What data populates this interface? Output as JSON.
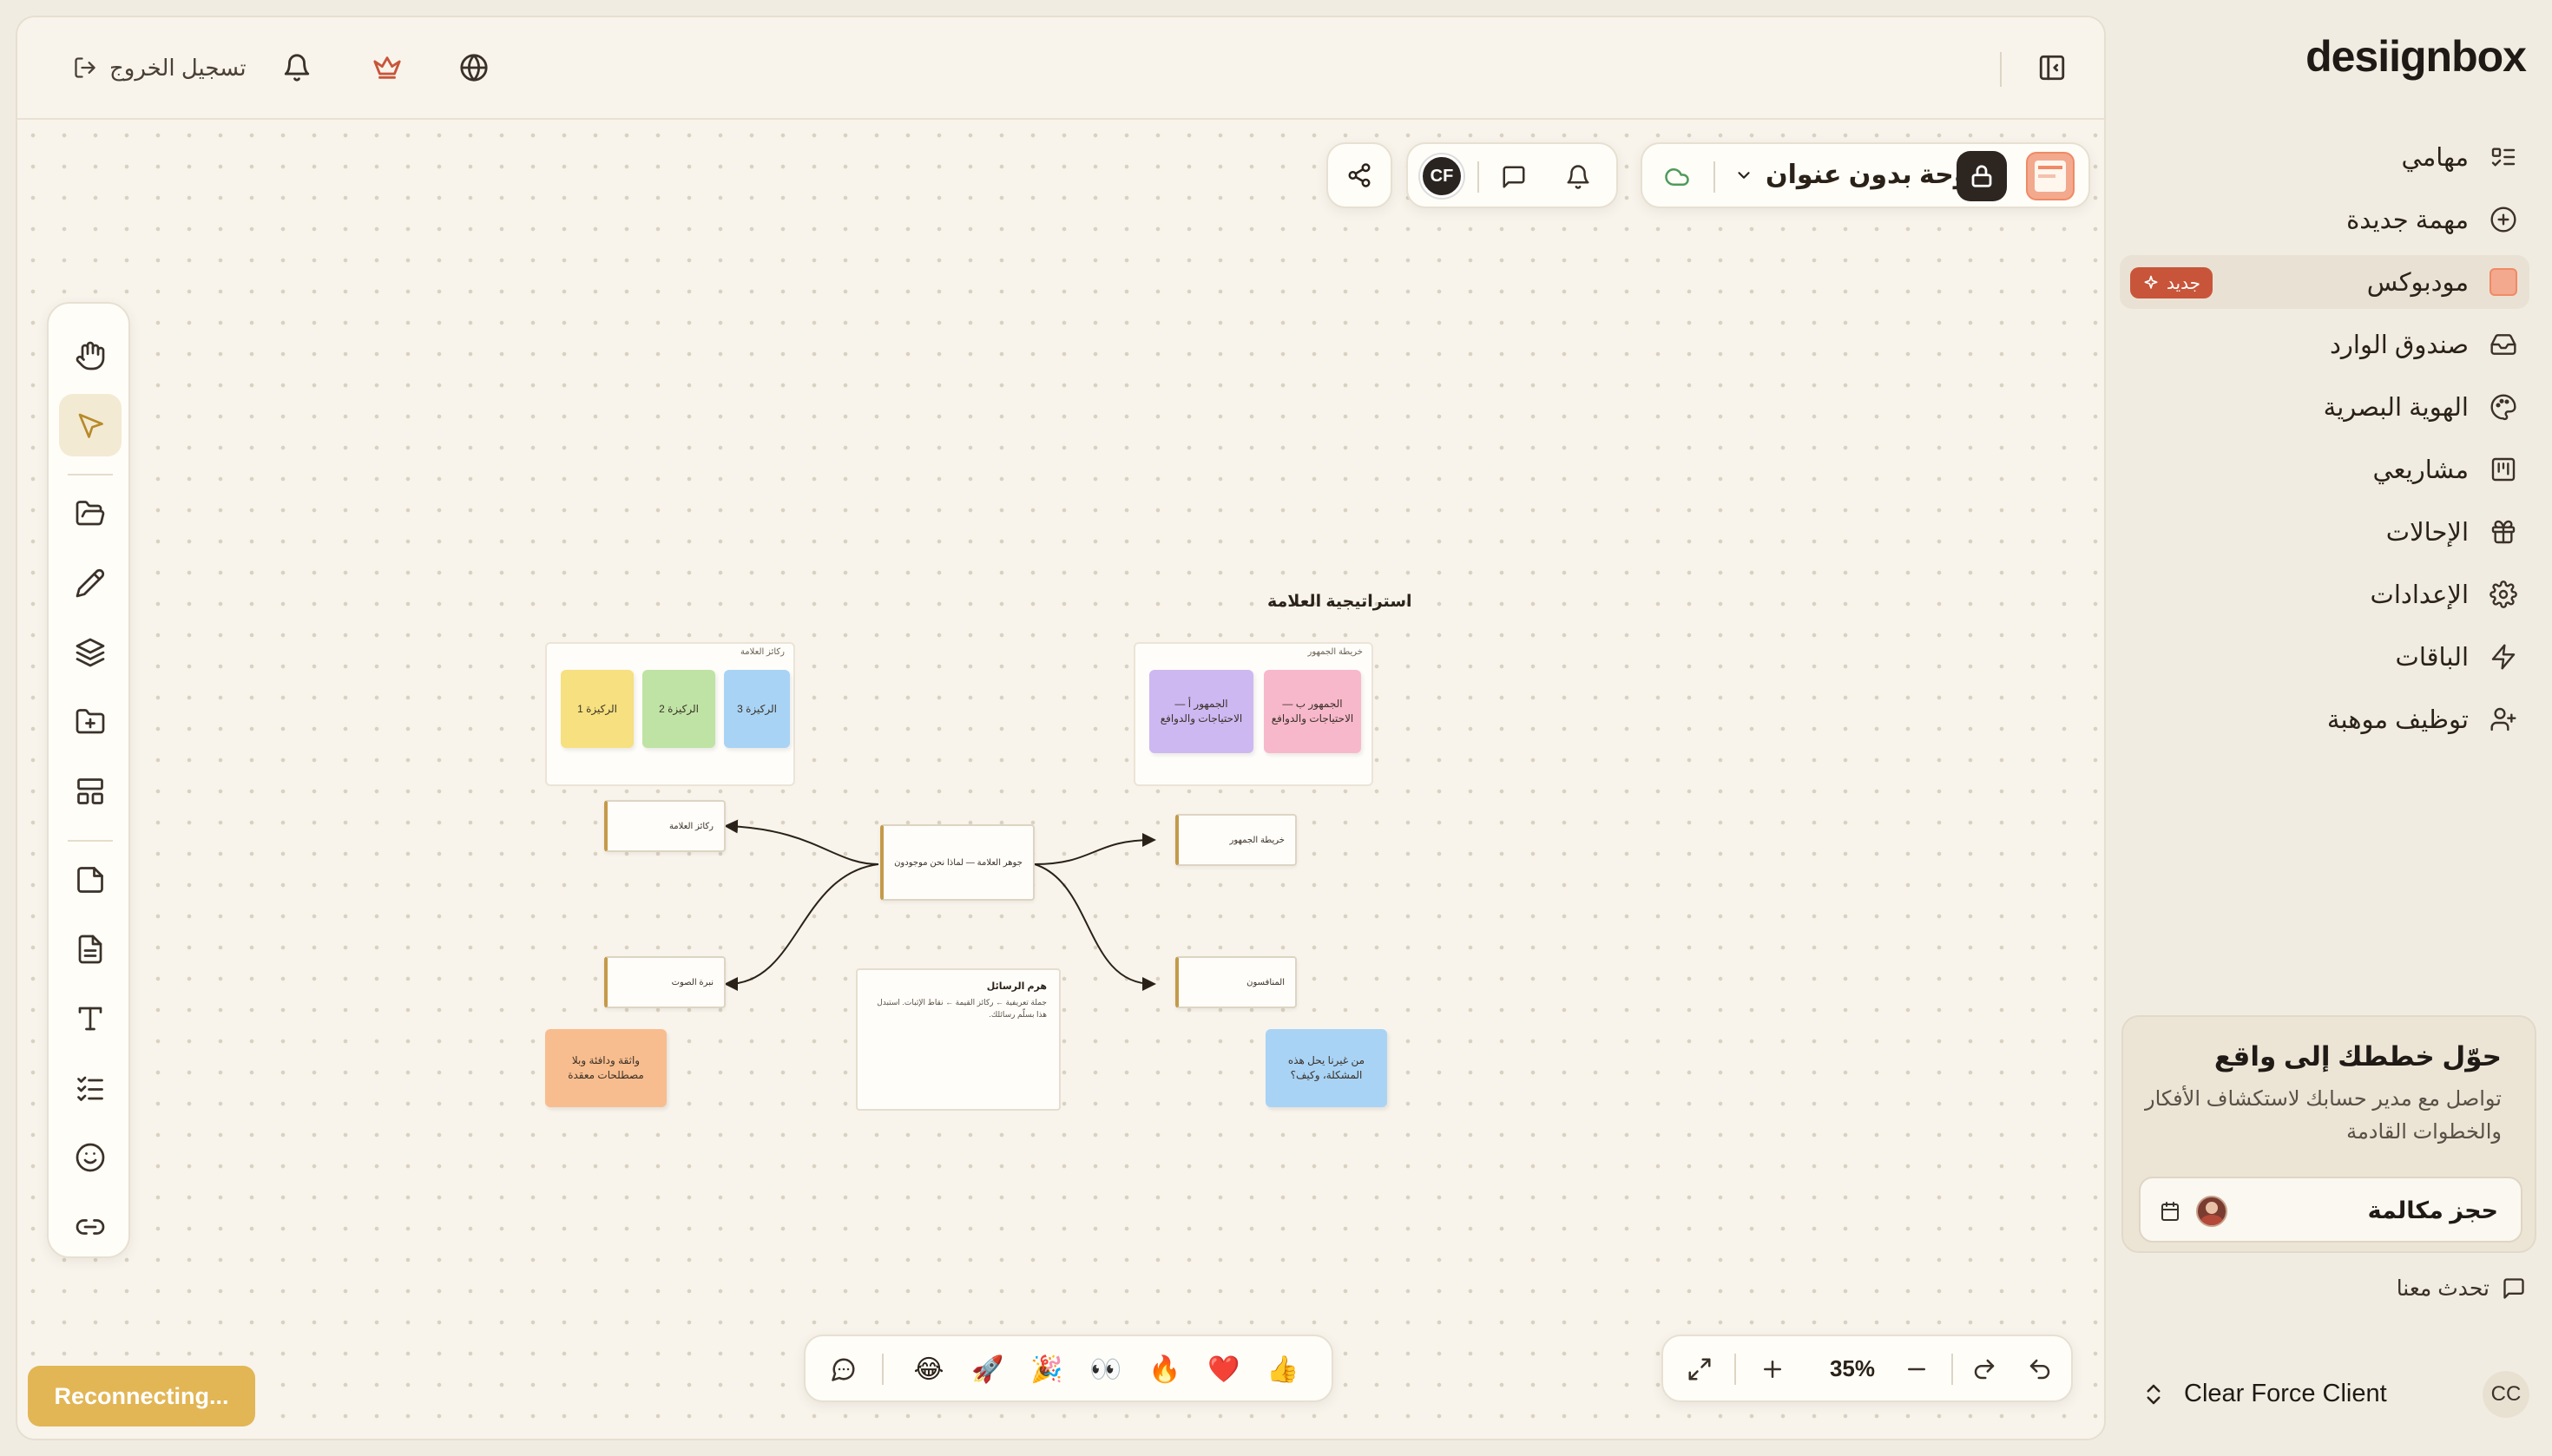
{
  "topbar": {
    "logout_label": "تسجيل الخروج",
    "crown_color": "#c8553a"
  },
  "board_header": {
    "title": "لوحة بدون عنوان",
    "avatar_initials": "CF"
  },
  "canvas": {
    "section_title": "استراتيجية العلامة",
    "frame_pillars_title": "ركائز العلامة",
    "frame_audience_title": "خريطة الجمهور",
    "pillar_1": "الركيزة 1",
    "pillar_2": "الركيزة 2",
    "pillar_3": "الركيزة 3",
    "audience_a": "الجمهور أ — الاحتياجات والدوافع",
    "audience_b": "الجمهور ب — الاحتياجات والدوافع",
    "center_node": "جوهر العلامة — لماذا نحن موجودون",
    "node_pillars": "ركائز العلامة",
    "node_tone": "نبرة الصوت",
    "node_audience": "خريطة الجمهور",
    "node_competitors": "المنافسون",
    "message_title": "هرم الرسائل",
    "message_body": "جملة تعريفية ← ركائز القيمة ← نقاط الإثبات. استبدل هذا بسلّم رسائلك.",
    "sticky_tone": "واثقة ودافئة وبلا مصطلحات معقدة",
    "sticky_question": "من غيرنا يحل هذه المشكلة، وكيف؟"
  },
  "reactions": [
    "👍",
    "❤️",
    "🔥",
    "👀",
    "🎉",
    "🚀",
    "😂"
  ],
  "zoom": {
    "value": "35%"
  },
  "status": {
    "reconnecting": "Reconnecting..."
  },
  "sidebar": {
    "logo": "desiignbox",
    "items": [
      {
        "label": "مهامي",
        "icon": "tasks-icon"
      },
      {
        "label": "مهمة جديدة",
        "icon": "plus-circle-icon"
      },
      {
        "label": "مودبوكس",
        "icon": "moodbox-icon",
        "badge": "جديد"
      },
      {
        "label": "صندوق الوارد",
        "icon": "inbox-icon"
      },
      {
        "label": "الهوية البصرية",
        "icon": "palette-icon"
      },
      {
        "label": "مشاريعي",
        "icon": "projects-icon"
      },
      {
        "label": "الإحالات",
        "icon": "gift-icon"
      },
      {
        "label": "الإعدادات",
        "icon": "gear-icon"
      },
      {
        "label": "الباقات",
        "icon": "bolt-icon"
      },
      {
        "label": "توظيف موهبة",
        "icon": "user-plus-icon"
      }
    ],
    "cta": {
      "title": "حوّل خططك إلى واقع",
      "text": "تواصل مع مدير حسابك لاستكشاف الأفكار والخطوات القادمة",
      "button": "حجز مكالمة"
    },
    "chat_label": "تحدث معنا",
    "client_name": "Clear Force Client",
    "client_initials": "CC"
  }
}
